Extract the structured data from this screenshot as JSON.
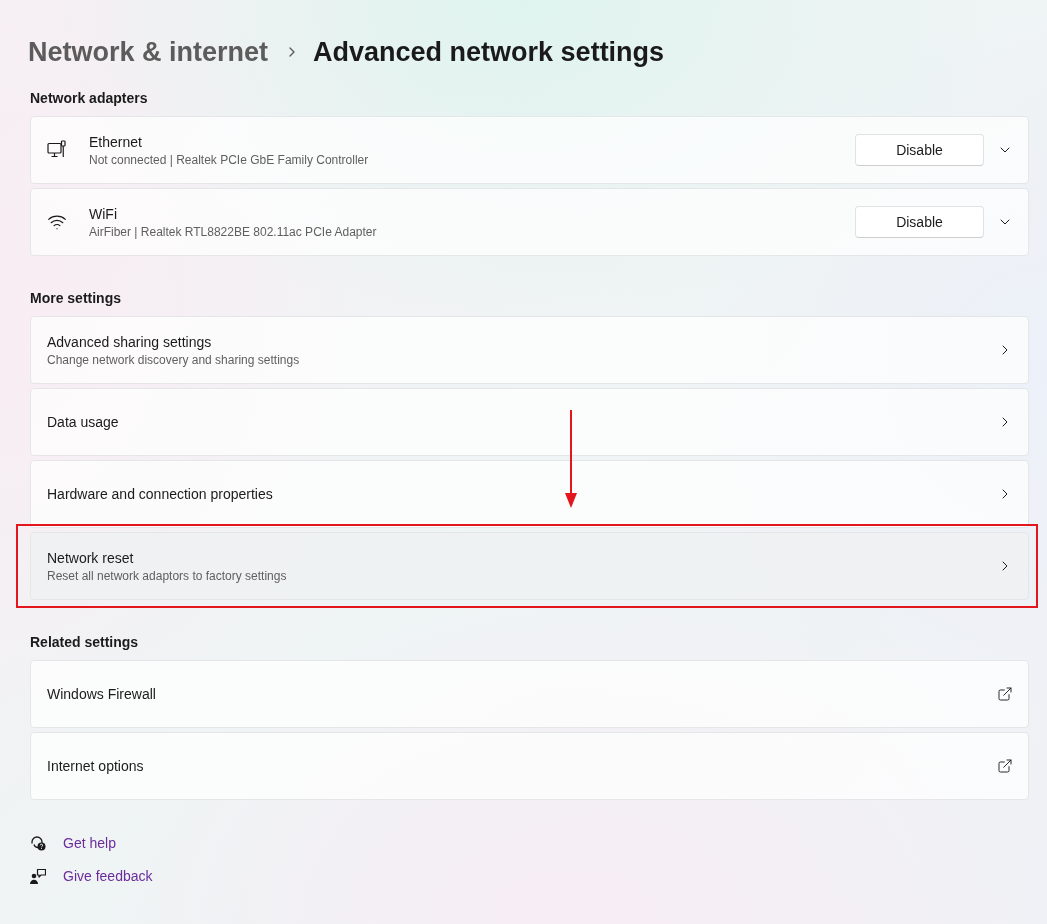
{
  "breadcrumb": {
    "parent": "Network & internet",
    "current": "Advanced network settings"
  },
  "network_adapters": {
    "heading": "Network adapters",
    "adapters": [
      {
        "kind": "ethernet",
        "name": "Ethernet",
        "description": "Not connected | Realtek PCIe GbE Family Controller",
        "button": "Disable",
        "expanded": false
      },
      {
        "kind": "wifi",
        "name": "WiFi",
        "description": "AirFiber | Realtek RTL8822BE 802.11ac PCIe Adapter",
        "button": "Disable",
        "expanded": false
      }
    ]
  },
  "more_settings": {
    "heading": "More settings",
    "items": [
      {
        "title": "Advanced sharing settings",
        "description": "Change network discovery and sharing settings",
        "hovered": false,
        "highlighted": false
      },
      {
        "title": "Data usage",
        "hovered": false,
        "highlighted": false
      },
      {
        "title": "Hardware and connection properties",
        "hovered": false,
        "highlighted": false
      },
      {
        "title": "Network reset",
        "description": "Reset all network adaptors to factory settings",
        "hovered": true,
        "highlighted": true
      }
    ]
  },
  "related_settings": {
    "heading": "Related settings",
    "items": [
      {
        "title": "Windows Firewall"
      },
      {
        "title": "Internet options"
      }
    ]
  },
  "footer_links": [
    {
      "kind": "help",
      "label": "Get help"
    },
    {
      "kind": "feedback",
      "label": "Give feedback"
    }
  ]
}
